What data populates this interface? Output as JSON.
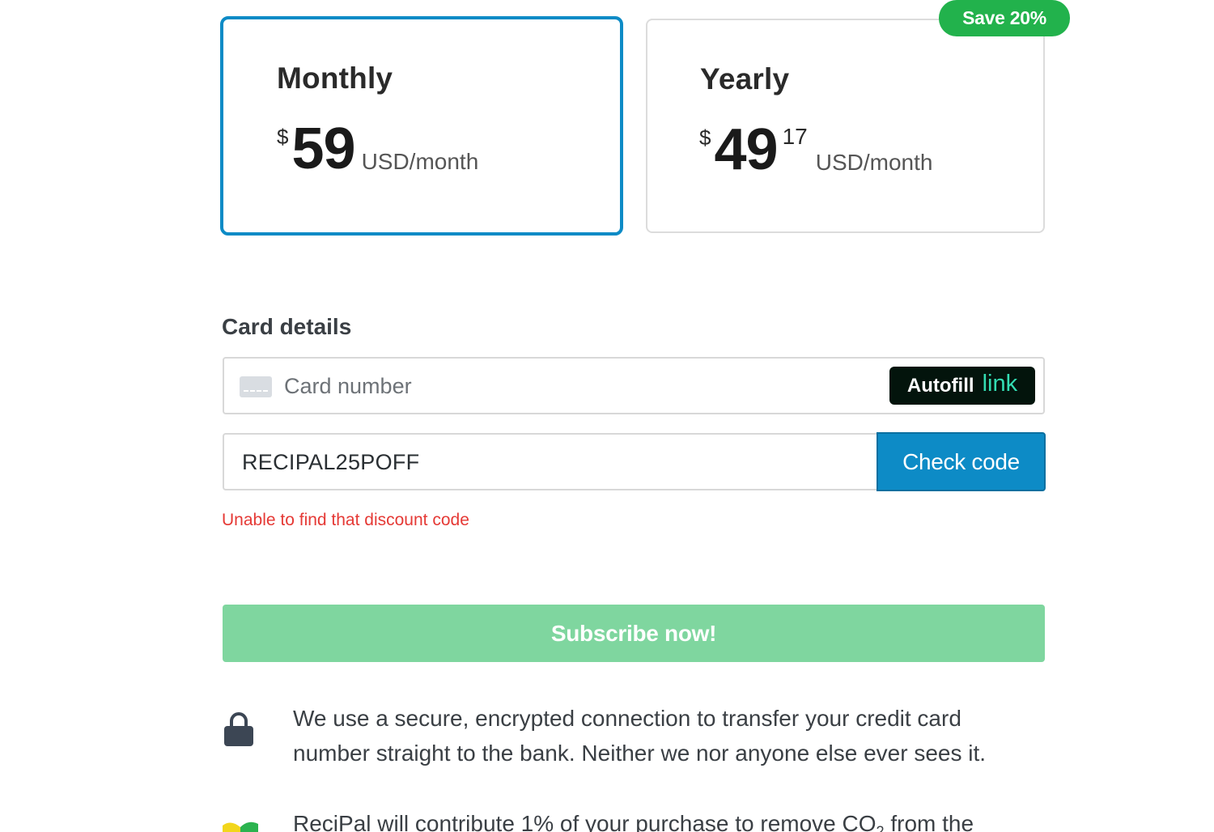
{
  "plans": {
    "monthly": {
      "name": "Monthly",
      "currency": "$",
      "amount": "59",
      "unit": "USD/month"
    },
    "yearly": {
      "name": "Yearly",
      "currency": "$",
      "amount": "49",
      "cents": "17",
      "unit": "USD/month",
      "badge": "Save 20%"
    }
  },
  "card_details": {
    "label": "Card details",
    "card_number_placeholder": "Card number",
    "autofill_label": "Autofill",
    "autofill_link": "link"
  },
  "discount": {
    "code_value": "RECIPAL25POFF",
    "check_button": "Check code",
    "error": "Unable to find that discount code"
  },
  "subscribe_button": "Subscribe now!",
  "info": {
    "secure_text": "We use a secure, encrypted connection to transfer your credit card number straight to the bank. Neither we nor anyone else ever sees it.",
    "co2_text_prefix": "ReciPal will contribute 1% of your purchase to remove CO",
    "co2_subscript": "2",
    "co2_text_suffix": " from the"
  },
  "colors": {
    "accent": "#0d8bc6",
    "badge_green": "#22b24c",
    "subscribe_green": "#7fd69f",
    "error_red": "#e53935",
    "autofill_bg": "#03140c",
    "link_green": "#33ddb3"
  },
  "icons": {
    "card": "credit-card-icon",
    "lock": "lock-icon",
    "leaf": "leaf-icon"
  }
}
